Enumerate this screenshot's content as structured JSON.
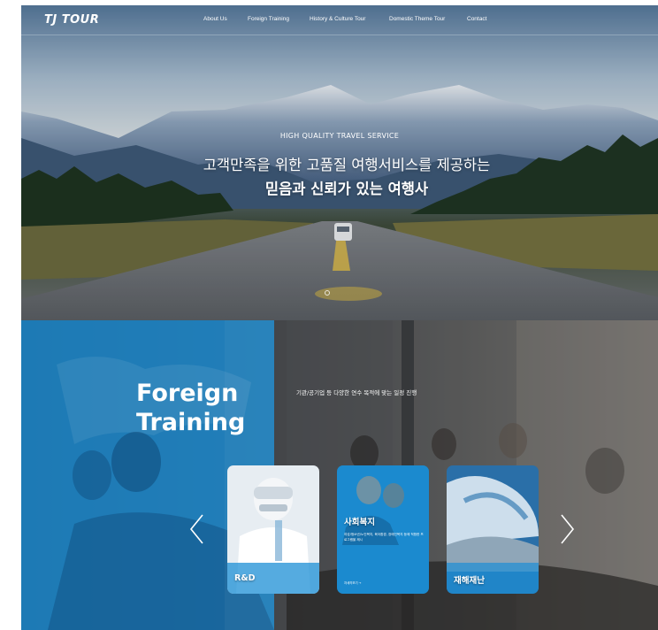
{
  "brand": {
    "logo": "TJ TOUR"
  },
  "nav": {
    "items": [
      {
        "label": "About Us"
      },
      {
        "label": "Foreign Training"
      },
      {
        "label": "History & Culture Tour"
      },
      {
        "label": "Domestic Theme Tour"
      },
      {
        "label": "Contact"
      }
    ]
  },
  "hero": {
    "subtitle": "HIGH QUALITY TRAVEL SERVICE",
    "line1": "고객만족을 위한 고품질 여행서비스를 제공하는",
    "line2": "믿음과 신뢰가 있는 여행사"
  },
  "training": {
    "title_line1": "Foreign",
    "title_line2": "Training",
    "description": "기관/공기업 등 다양한 연수 목적에 맞는 일정 진행",
    "cards": [
      {
        "title": "R&D",
        "text": "",
        "more": ""
      },
      {
        "title": "사회복지",
        "text": "여성/청소년/노인복지, 육아환경, 장애인복지 등에 적합한 프로그램을 제시",
        "more": "자세히보기 →"
      },
      {
        "title": "재해재난",
        "text": "",
        "more": ""
      }
    ]
  },
  "icons": {
    "prev": "chevron-left-icon",
    "next": "chevron-right-icon",
    "pager": "pager-dot-icon"
  },
  "colors": {
    "accent_blue": "#188ed8",
    "card_blue": "#1c8fd6",
    "text_white": "#ffffff"
  }
}
